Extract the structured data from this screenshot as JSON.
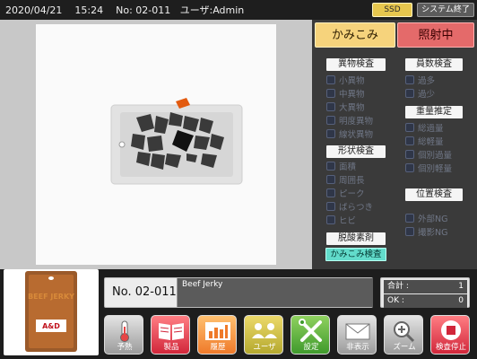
{
  "status_bar": {
    "date": "2020/04/21",
    "time": "15:24",
    "product_no": "No: 02-011",
    "user": "ユーザ:Admin"
  },
  "top_buttons": {
    "ssd": "SSD",
    "system_exit": "システム終了"
  },
  "modes": {
    "kamikomi": "かみこみ",
    "shosha": "照射中"
  },
  "right_panel": {
    "ibutsu": {
      "title": "異物検査",
      "items": [
        "小異物",
        "中異物",
        "大異物",
        "明度異物",
        "線状異物"
      ]
    },
    "keijo": {
      "title": "形状検査",
      "items": [
        "面積",
        "周囲長",
        "ピーク",
        "ばらつき",
        "ヒビ"
      ]
    },
    "dassanso": {
      "title": "脱酸素剤"
    },
    "kamikomi_check": "かみこみ検査",
    "kosu": {
      "title": "員数検査",
      "items": [
        "過多",
        "過少"
      ]
    },
    "juryo": {
      "title": "重量推定",
      "items": [
        "総過量",
        "総軽量",
        "個別過量",
        "個別軽量"
      ]
    },
    "ichi": {
      "title": "位置検査",
      "items": [
        "外部NG",
        "撮影NG"
      ]
    }
  },
  "product": {
    "no": "No. 02-011",
    "name": "Beef Jerky",
    "thumb_title": "BEEF JERKY",
    "thumb_logo": "A&D"
  },
  "counts": {
    "total_label": "合計 :",
    "total_value": "1",
    "ok_label": "OK :",
    "ok_value": "0"
  },
  "toolbar": [
    {
      "label": "予熱",
      "icon": "thermometer-icon"
    },
    {
      "label": "製品",
      "icon": "book-icon"
    },
    {
      "label": "履歴",
      "icon": "history-chart-icon"
    },
    {
      "label": "ユーザ",
      "icon": "users-icon"
    },
    {
      "label": "設定",
      "icon": "tools-icon"
    },
    {
      "label": "非表示",
      "icon": "envelope-icon"
    },
    {
      "label": "ズーム",
      "icon": "magnifier-icon"
    },
    {
      "label": "検査停止",
      "icon": "stop-icon"
    }
  ]
}
